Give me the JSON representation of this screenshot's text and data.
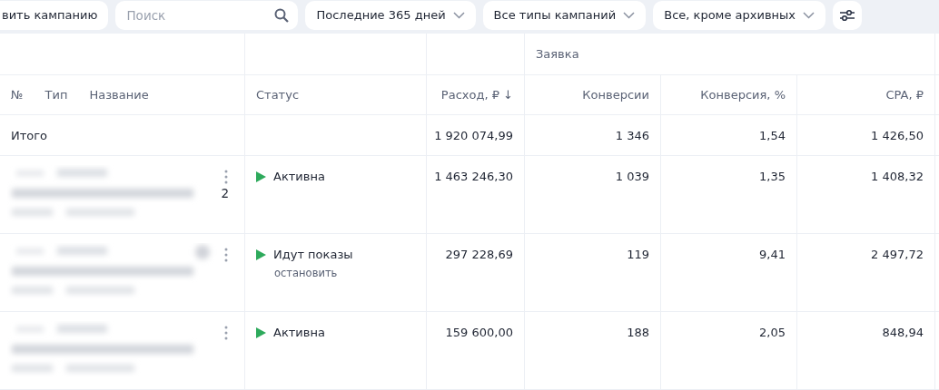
{
  "toolbar": {
    "add_button": "вить кампанию",
    "search": {
      "placeholder": "Поиск"
    },
    "filters": [
      "Последние 365 дней",
      "Все типы кампаний",
      "Все, кроме архивных"
    ]
  },
  "table": {
    "group_header": "Заявка",
    "name_headers": [
      "№",
      "Тип",
      "Название"
    ],
    "columns": [
      {
        "label": "Статус"
      },
      {
        "label": "Расход, ₽",
        "sort_mark": "↓"
      },
      {
        "label": "Конверсии"
      },
      {
        "label": "Конверсия, %"
      },
      {
        "label": "CPA, ₽"
      }
    ],
    "total": {
      "label": "Итого",
      "values": [
        "1 920 074,99",
        "1 346",
        "1,54",
        "1 426,50"
      ]
    },
    "rows": [
      {
        "number_fragment": "2",
        "has_badge": false,
        "status": {
          "text": "Активна"
        },
        "values": [
          "1 463 246,30",
          "1 039",
          "1,35",
          "1 408,32"
        ]
      },
      {
        "has_badge": true,
        "status": {
          "text": "Идут показы",
          "action": "остановить"
        },
        "values": [
          "297 228,69",
          "119",
          "9,41",
          "2 497,72"
        ]
      },
      {
        "has_badge": false,
        "status": {
          "text": "Активна"
        },
        "values": [
          "159 600,00",
          "188",
          "2,05",
          "848,94"
        ]
      }
    ]
  }
}
